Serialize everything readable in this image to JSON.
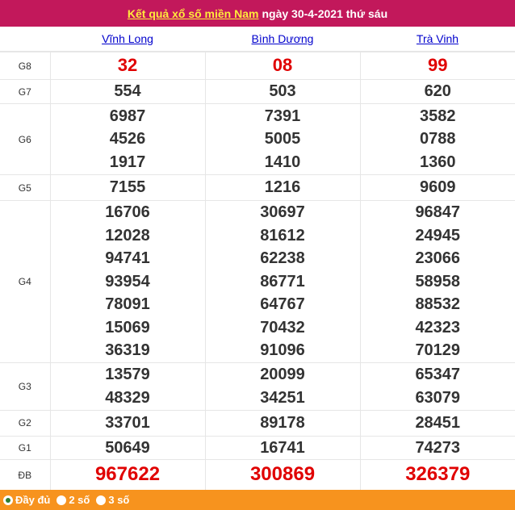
{
  "header": {
    "title_link": "Kết quả xổ số miền Nam",
    "title_rest": "ngày 30-4-2021 thứ sáu"
  },
  "provinces": [
    "Vĩnh Long",
    "Bình Dương",
    "Trà Vinh"
  ],
  "prizes": [
    {
      "label": "G8",
      "values": [
        [
          "32"
        ],
        [
          "08"
        ],
        [
          "99"
        ]
      ]
    },
    {
      "label": "G7",
      "values": [
        [
          "554"
        ],
        [
          "503"
        ],
        [
          "620"
        ]
      ]
    },
    {
      "label": "G6",
      "values": [
        [
          "6987",
          "4526",
          "1917"
        ],
        [
          "7391",
          "5005",
          "1410"
        ],
        [
          "3582",
          "0788",
          "1360"
        ]
      ]
    },
    {
      "label": "G5",
      "values": [
        [
          "7155"
        ],
        [
          "1216"
        ],
        [
          "9609"
        ]
      ]
    },
    {
      "label": "G4",
      "values": [
        [
          "16706",
          "12028",
          "94741",
          "93954",
          "78091",
          "15069",
          "36319"
        ],
        [
          "30697",
          "81612",
          "62238",
          "86771",
          "64767",
          "70432",
          "91096"
        ],
        [
          "96847",
          "24945",
          "23066",
          "58958",
          "88532",
          "42323",
          "70129"
        ]
      ]
    },
    {
      "label": "G3",
      "values": [
        [
          "13579",
          "48329"
        ],
        [
          "20099",
          "34251"
        ],
        [
          "65347",
          "63079"
        ]
      ]
    },
    {
      "label": "G2",
      "values": [
        [
          "33701"
        ],
        [
          "89178"
        ],
        [
          "28451"
        ]
      ]
    },
    {
      "label": "G1",
      "values": [
        [
          "50649"
        ],
        [
          "16741"
        ],
        [
          "74273"
        ]
      ]
    },
    {
      "label": "ĐB",
      "values": [
        [
          "967622"
        ],
        [
          "300869"
        ],
        [
          "326379"
        ]
      ]
    }
  ],
  "footer": {
    "options": [
      "Đầy đủ",
      "2 số",
      "3 số"
    ],
    "selected": 0
  }
}
